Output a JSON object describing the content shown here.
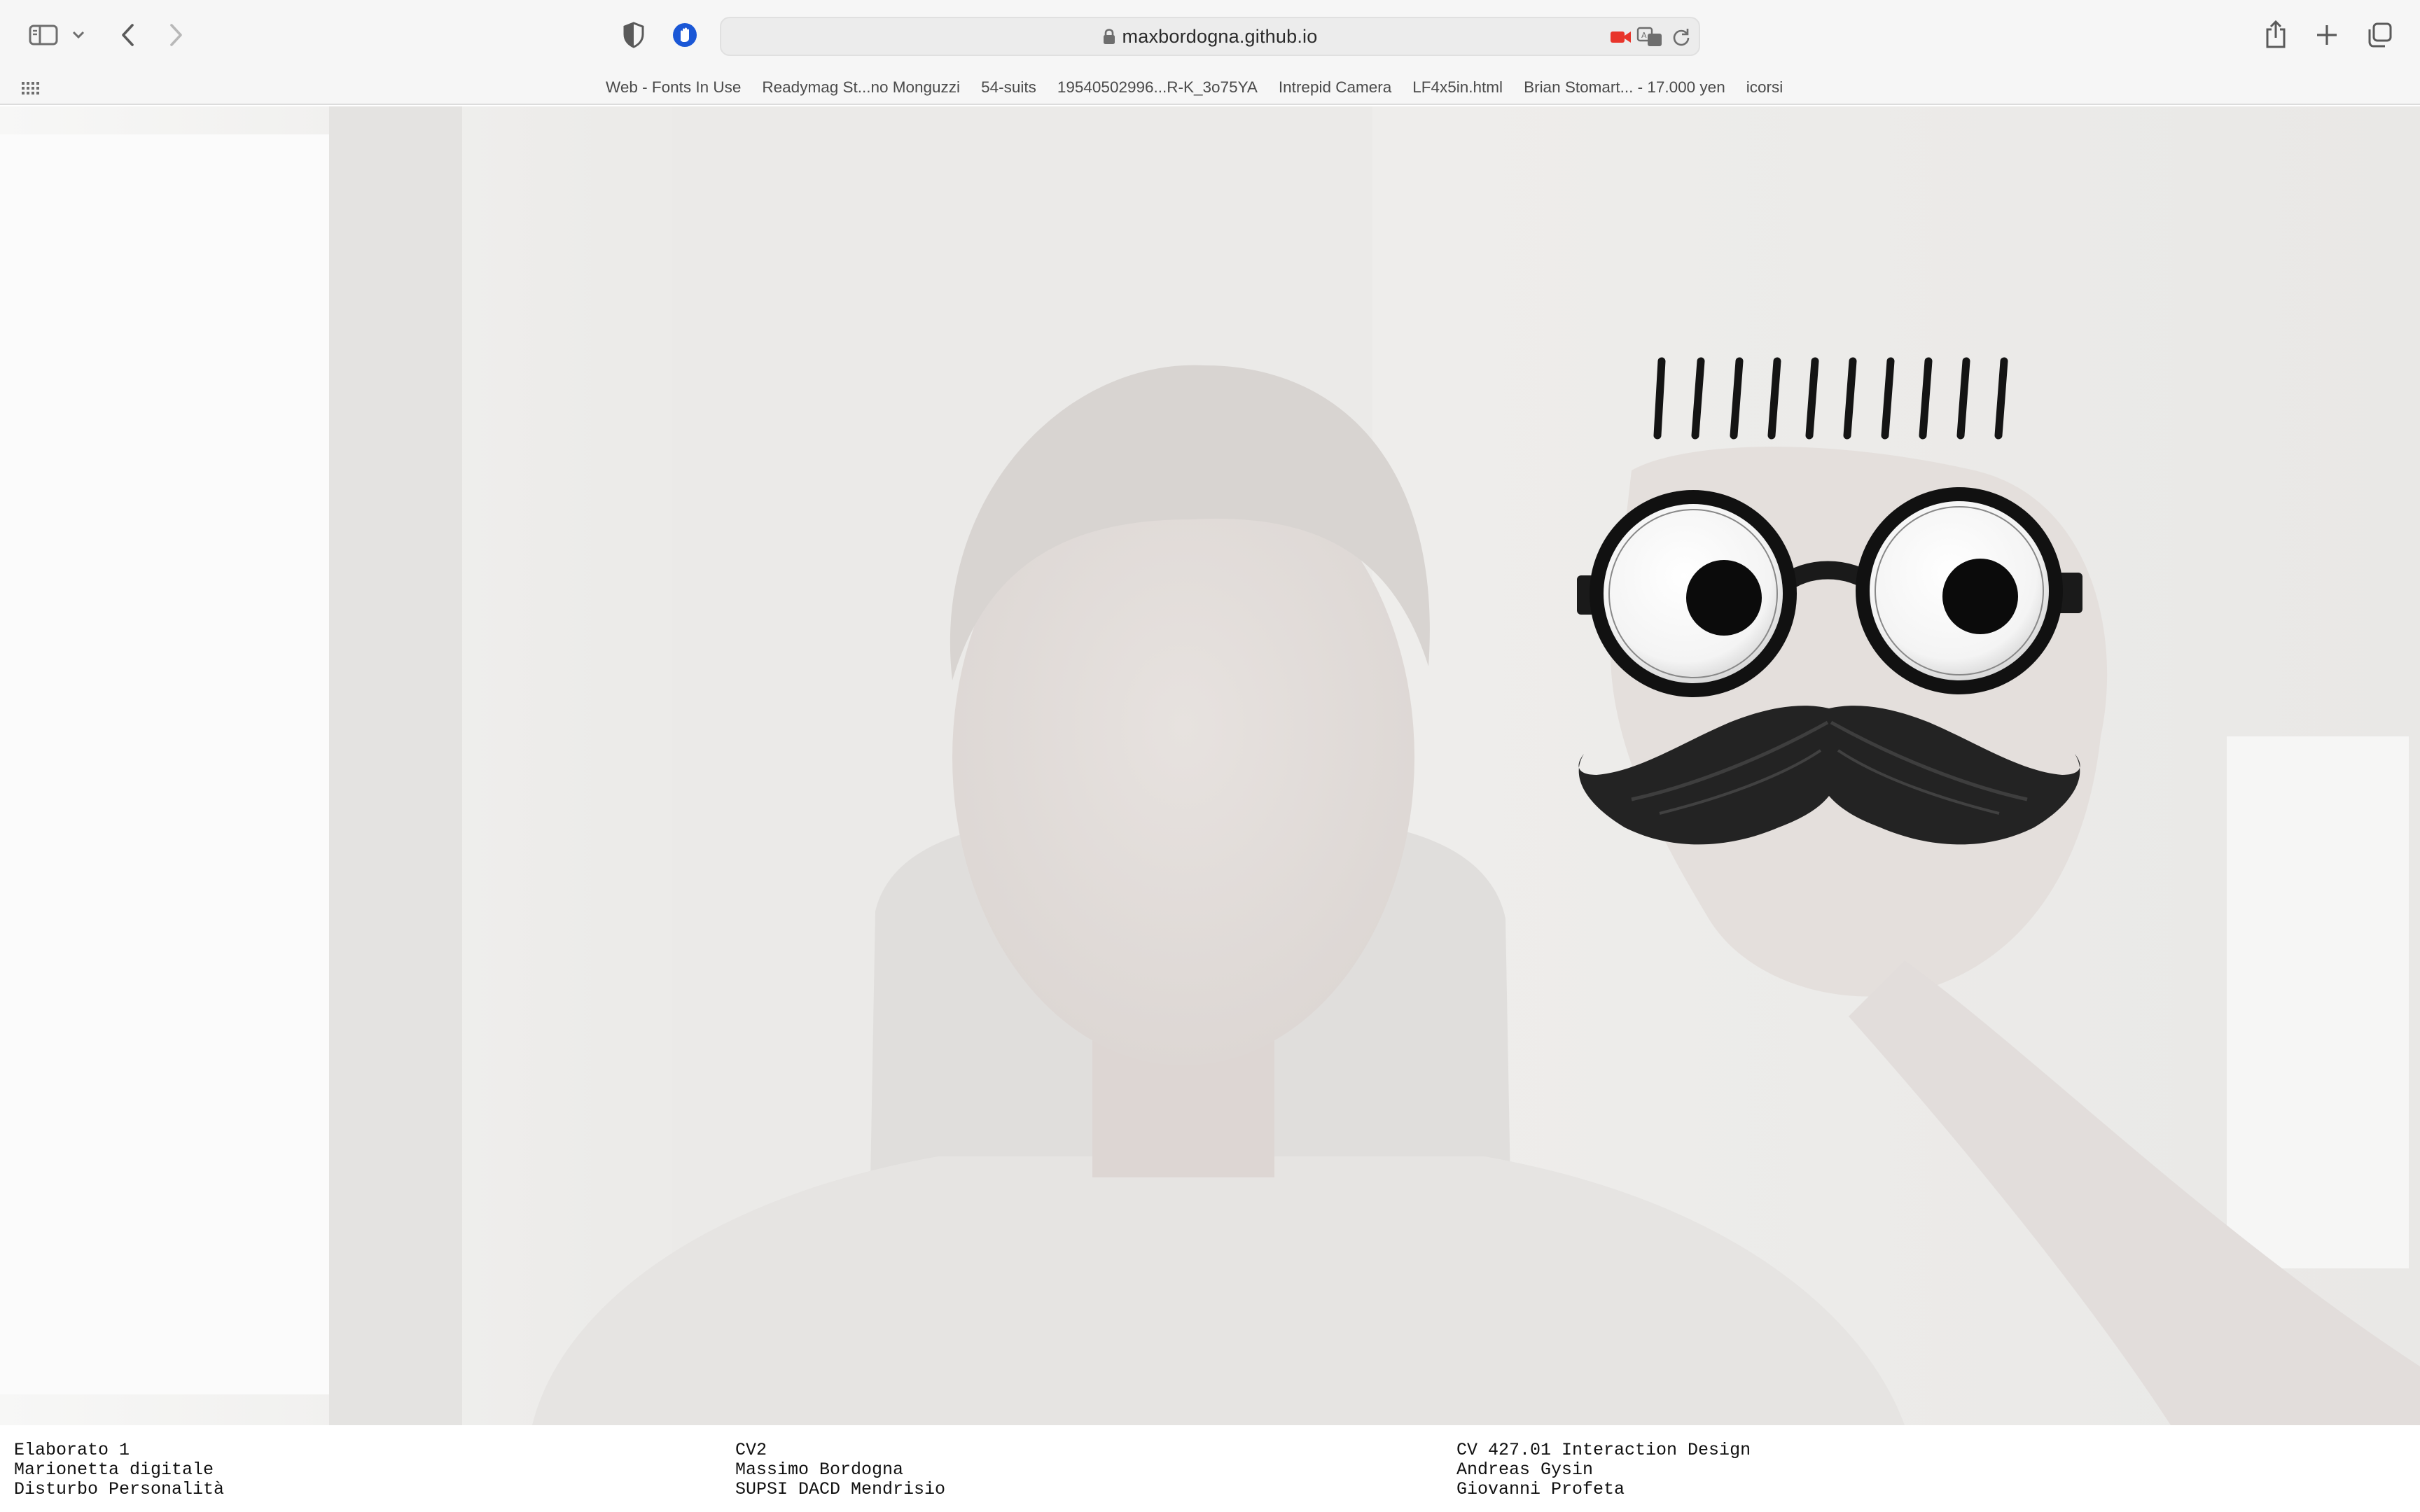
{
  "browser": {
    "address": "maxbordogna.github.io",
    "icons": [
      "sidebar-icon",
      "chevron-down-icon",
      "back-icon",
      "forward-icon",
      "shield-icon",
      "extension-icon",
      "lock-icon",
      "camera-icon",
      "translate-icon",
      "reload-icon",
      "share-icon",
      "plus-icon",
      "tabs-icon",
      "grid-icon"
    ]
  },
  "bookmarks": [
    "Web - Fonts In Use",
    "Readymag St...no Monguzzi",
    "54-suits",
    "19540502996...R-K_3o75YA",
    "Intrepid Camera",
    "LF4x5in.html",
    "Brian Stomart... - 17.000 yen",
    "icorsi"
  ],
  "overlay": {
    "description_icons": [
      "eyebrow-icon",
      "glasses-icon",
      "mustache-icon"
    ],
    "colors": {
      "ink": "#141414",
      "webcam_bg": "#efeeec"
    }
  },
  "footer": {
    "col1": [
      "Elaborato 1",
      "Marionetta digitale",
      "Disturbo Personalità"
    ],
    "col2": [
      "CV2",
      "Massimo Bordogna",
      "SUPSI DACD Mendrisio"
    ],
    "col3": [
      "CV 427.01 Interaction Design",
      "Andreas Gysin",
      "Giovanni Profeta"
    ]
  }
}
